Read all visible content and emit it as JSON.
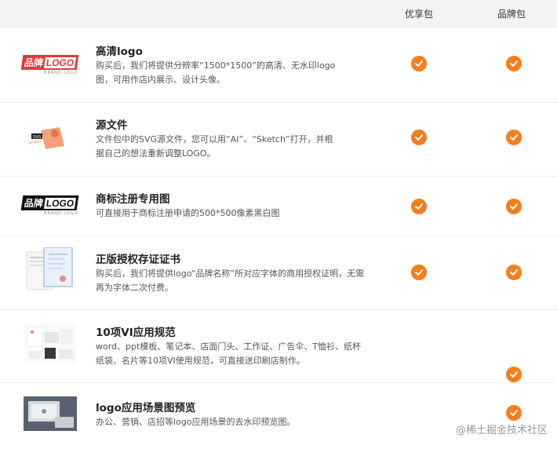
{
  "header": {
    "col1": "优享包",
    "col2": "品牌包"
  },
  "rows": [
    {
      "title": "高清logo",
      "desc": "购买后，我们将提供分辨率“1500*1500”的高清、无水印logo图，可用作店内展示、设计头像。",
      "thumb_icon": "logo-red-thumbnail",
      "thumb_text_a": "品牌",
      "thumb_text_b": "LOGO",
      "thumb_sub": "BRAND LOGO",
      "col1": true,
      "col2": true
    },
    {
      "title": "源文件",
      "desc": "文件包中的SVG源文件，您可以用“AI”、“Sketch”打开，并根据自己的想法重新调整LOGO。",
      "thumb_icon": "source-file-thumbnail",
      "thumb_label": "SVG",
      "col1": true,
      "col2": true
    },
    {
      "title": "商标注册专用图",
      "desc": "可直接用于商标注册申请的500*500像素黑白图",
      "thumb_icon": "logo-black-thumbnail",
      "thumb_text_a": "品牌",
      "thumb_text_b": "LOGO",
      "thumb_sub": "BRAND LOGO",
      "col1": true,
      "col2": true
    },
    {
      "title": "正版授权存证证书",
      "desc": "购买后，我们将提供logo“品牌名称”所对应字体的商用授权证明，无需再为字体二次付费。",
      "thumb_icon": "certificate-thumbnail",
      "col1": true,
      "col2": true
    },
    {
      "title": "10项VI应用规范",
      "desc": "word、ppt模板、笔记本、店面门头、工作证、广告伞、T恤衫、纸杯纸袋、名片等10项VI使用规范，可直接送印刷店制作。",
      "thumb_icon": "vi-spec-thumbnail",
      "col1": false,
      "col2": true
    },
    {
      "title": "logo应用场景图预览",
      "desc": "办公、营销、店招等logo应用场景的去水印预览图。",
      "thumb_icon": "laptop-mockup-thumbnail",
      "col1": false,
      "col2": true
    }
  ],
  "watermark": "@稀土掘金技术社区",
  "colors": {
    "check": "#f57e1e",
    "header_bg": "#f3f3f3",
    "border": "#efefef"
  }
}
